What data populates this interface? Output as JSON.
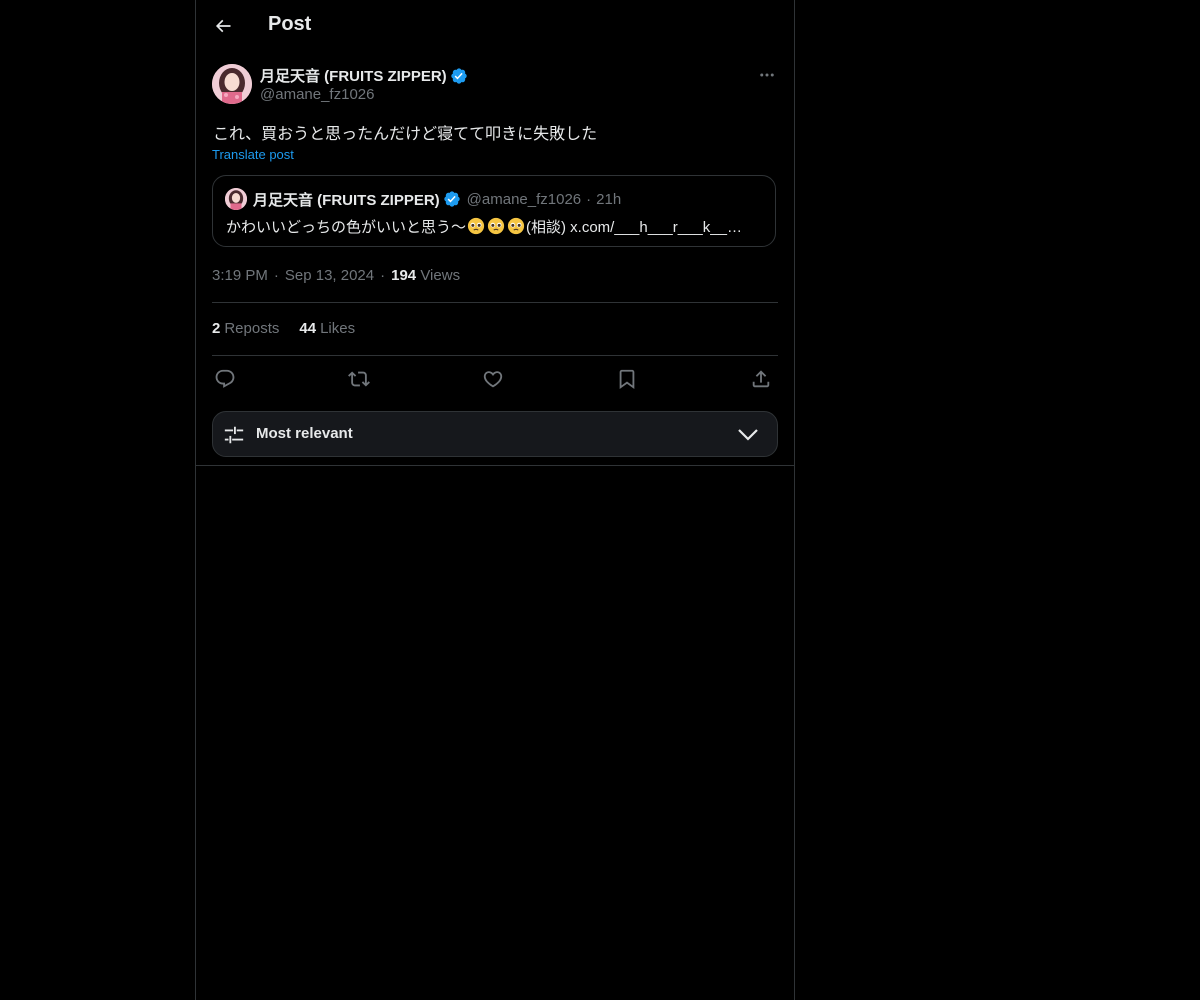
{
  "header": {
    "title": "Post",
    "back_icon": "arrow-left-icon"
  },
  "post": {
    "author_name": "月足天音 (FRUITS ZIPPER)",
    "author_handle": "@amane_fz1026",
    "verified": true,
    "text": "これ、買おうと思ったんだけど寝てて叩きに失敗した",
    "translate_label": "Translate post",
    "time": "3:19 PM",
    "date": "Sep 13, 2024",
    "views_count": "194",
    "views_label": "Views",
    "reposts_count": "2",
    "reposts_label": "Reposts",
    "likes_count": "44",
    "likes_label": "Likes"
  },
  "quote": {
    "author_name": "月足天音 (FRUITS ZIPPER)",
    "author_handle": "@amane_fz1026",
    "time": "21h",
    "text_before": "かわいいどっちの色がいいと思う〜",
    "text_after": "(相談) x.com/___h___r___k__…",
    "emoji": "pleading-face-emoji"
  },
  "sort": {
    "label": "Most relevant"
  },
  "colors": {
    "background": "#000000",
    "text": "#e7e9ea",
    "secondary_text": "#71767b",
    "accent": "#1d9bf0",
    "border": "#2f3336",
    "verified_badge": "#1d9bf0"
  }
}
